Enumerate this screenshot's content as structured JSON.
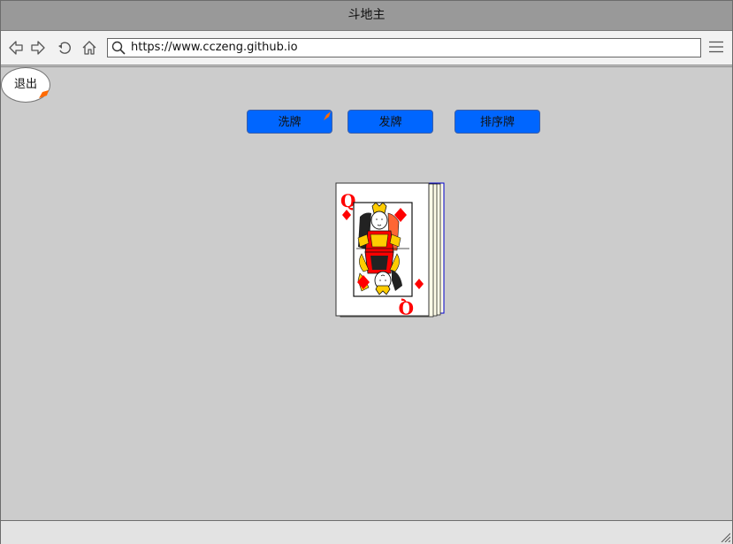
{
  "window": {
    "title": "斗地主"
  },
  "toolbar": {
    "url": "https://www.cczeng.github.io",
    "icons": [
      "back-icon",
      "forward-icon",
      "refresh-icon",
      "home-icon",
      "search-icon",
      "menu-icon"
    ]
  },
  "game": {
    "exit_label": "退出",
    "buttons": [
      {
        "label": "洗牌"
      },
      {
        "label": "发牌"
      },
      {
        "label": "排序牌"
      }
    ],
    "card": {
      "rank": "Q",
      "suit": "diamond",
      "face": "queen"
    }
  },
  "colors": {
    "button_blue": "#0066ff",
    "background": "#cccccc",
    "card_red": "#ff0000",
    "badge_orange": "#ff6a00"
  }
}
